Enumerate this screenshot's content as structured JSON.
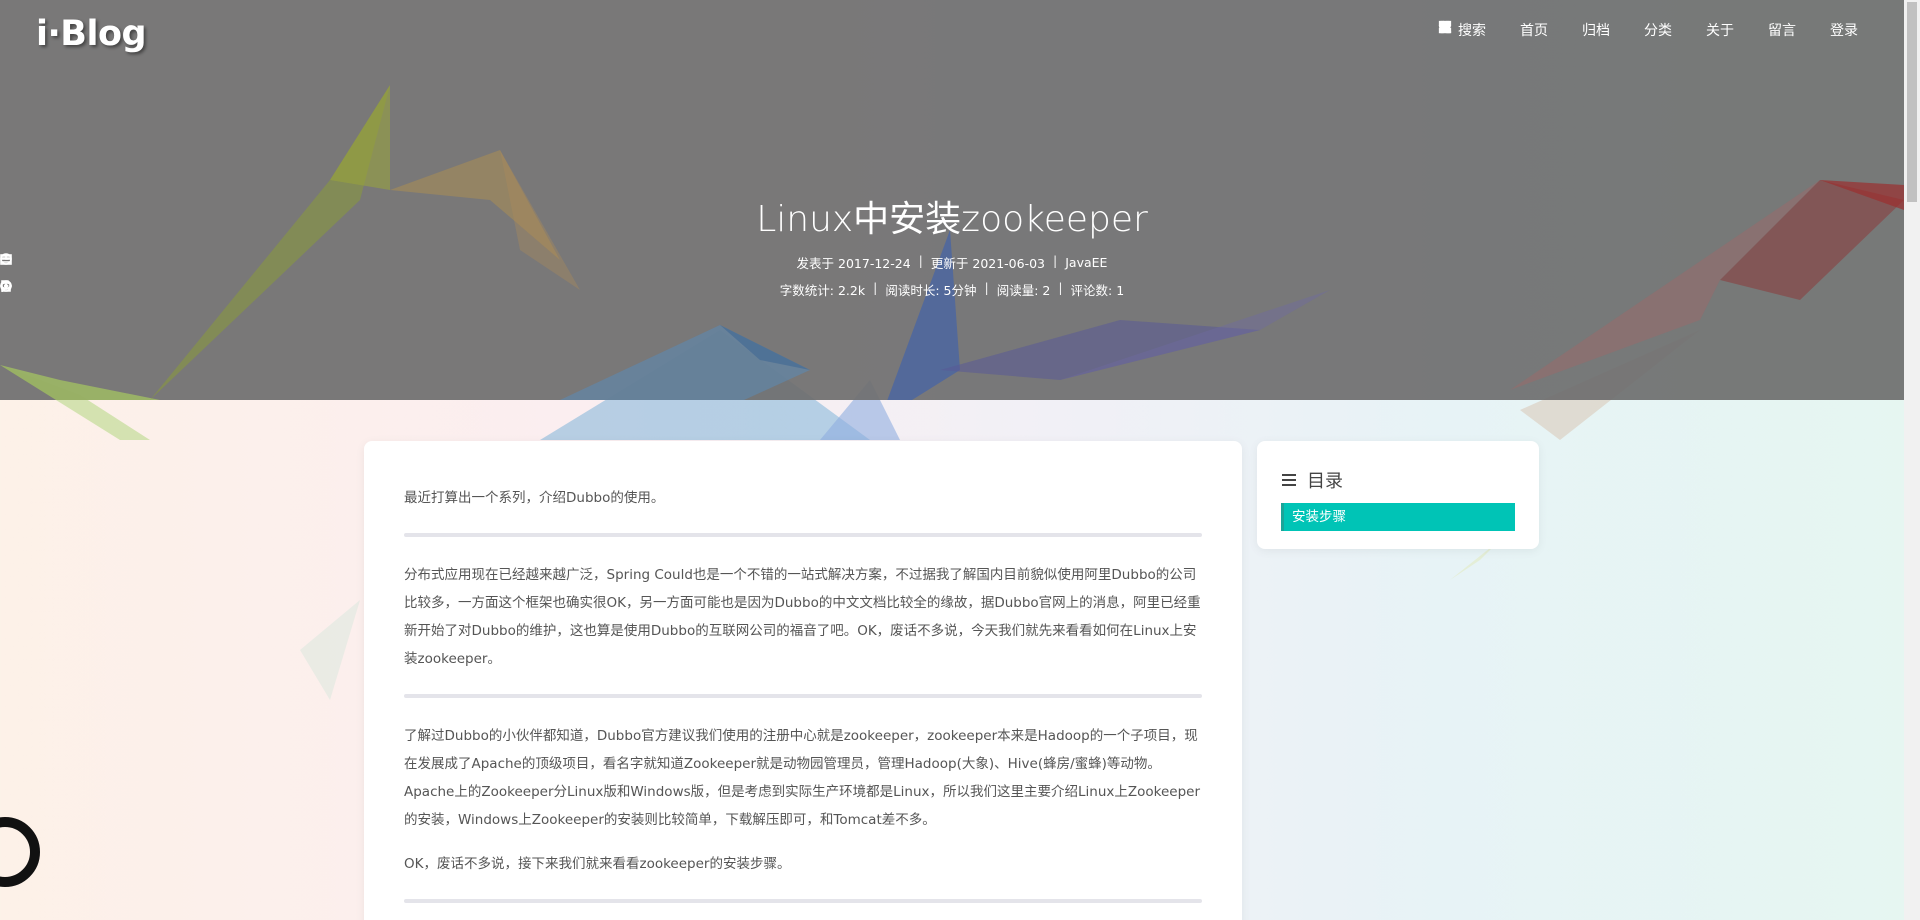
{
  "header": {
    "logo": "i·Blog",
    "nav": [
      {
        "label": "搜索",
        "icon": "search-icon"
      },
      {
        "label": "首页",
        "icon": "home-icon"
      },
      {
        "label": "归档",
        "icon": "archive-icon"
      },
      {
        "label": "分类",
        "icon": "grid-icon"
      },
      {
        "label": "关于",
        "icon": "send-icon"
      },
      {
        "label": "留言",
        "icon": "comment-icon"
      },
      {
        "label": "登录",
        "icon": "user-icon"
      }
    ]
  },
  "post": {
    "title": "Linux中安装zookeeper",
    "published": "发表于 2017-12-24",
    "updated": "更新于 2021-06-03",
    "category": "JavaEE",
    "word_count": "字数统计: 2.2k",
    "read_time": "阅读时长: 5分钟",
    "views": "阅读量: 2",
    "comments": "评论数: 1",
    "paragraphs": {
      "p1": "最近打算出一个系列，介绍Dubbo的使用。",
      "p2": "分布式应用现在已经越来越广泛，Spring Could也是一个不错的一站式解决方案，不过据我了解国内目前貌似使用阿里Dubbo的公司比较多，一方面这个框架也确实很OK，另一方面可能也是因为Dubbo的中文文档比较全的缘故，据Dubbo官网上的消息，阿里已经重新开始了对Dubbo的维护，这也算是使用Dubbo的互联网公司的福音了吧。OK，废话不多说，今天我们就先来看看如何在Linux上安装zookeeper。",
      "p3": "了解过Dubbo的小伙伴都知道，Dubbo官方建议我们使用的注册中心就是zookeeper，zookeeper本来是Hadoop的一个子项目，现在发展成了Apache的顶级项目，看名字就知道Zookeeper就是动物园管理员，管理Hadoop(大象)、Hive(蜂房/蜜蜂)等动物。Apache上的Zookeeper分Linux版和Windows版，但是考虑到实际生产环境都是Linux，所以我们这里主要介绍Linux上Zookeeper的安装，Windows上Zookeeper的安装则比较简单，下载解压即可，和Tomcat差不多。",
      "p4": "OK，废话不多说，接下来我们就来看看zookeeper的安装步骤。"
    }
  },
  "toc": {
    "title": "目录",
    "items": [
      "安装步骤"
    ],
    "active_color": "#00c4b6"
  }
}
